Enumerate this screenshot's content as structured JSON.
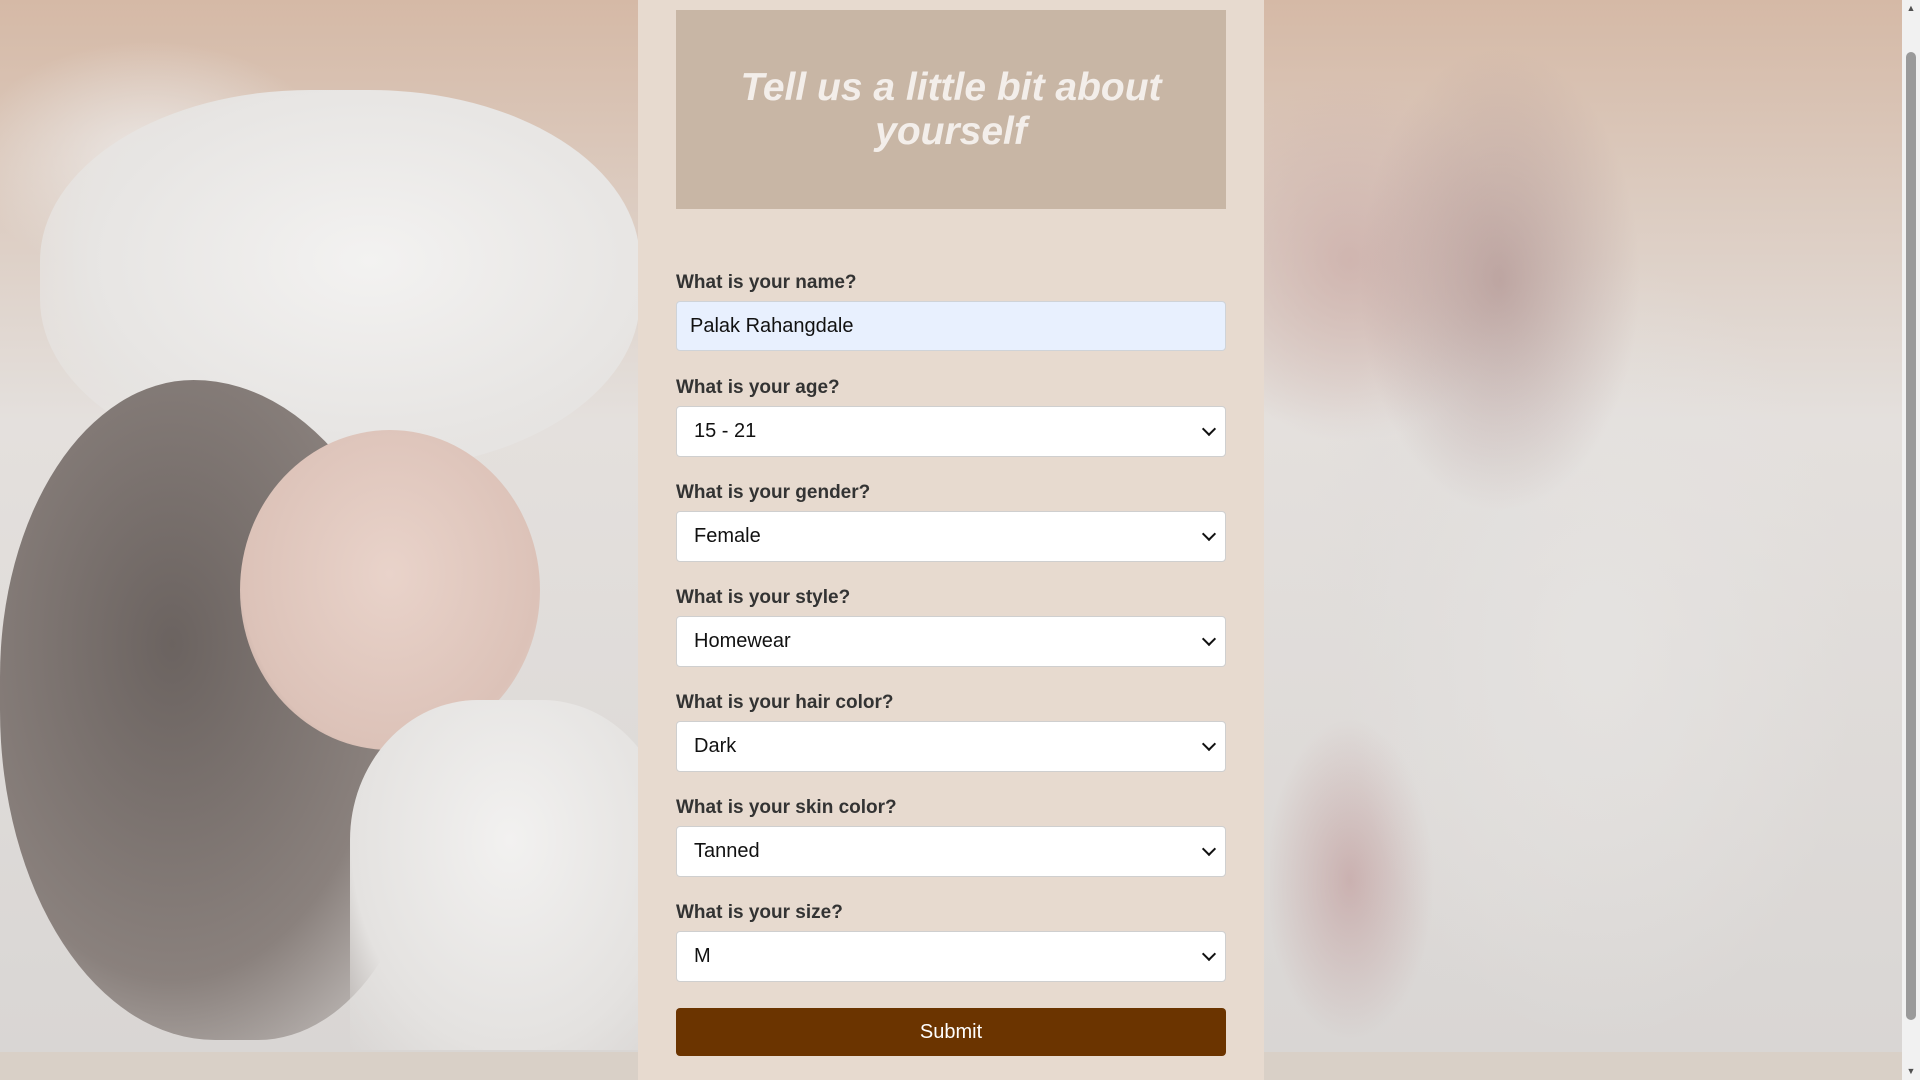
{
  "form": {
    "heading": "Tell us a little bit about yourself",
    "fields": [
      {
        "label": "What is your name?",
        "value": "Palak Rahangdale"
      },
      {
        "label": "What is your age?",
        "value": "15 - 21"
      },
      {
        "label": "What is your gender?",
        "value": "Female"
      },
      {
        "label": "What is your style?",
        "value": "Homewear"
      },
      {
        "label": "What is your hair color?",
        "value": "Dark"
      },
      {
        "label": "What is your skin color?",
        "value": "Tanned"
      },
      {
        "label": "What is your size?",
        "value": "M"
      }
    ],
    "submit_label": "Submit"
  },
  "icons": {
    "select_arrow": "chevron-down-icon",
    "scroll_up": "arrow-up-icon",
    "scroll_down": "arrow-down-icon"
  },
  "colors": {
    "panel_bg": "#e7dacf",
    "header_bg": "#c8b6a5",
    "submit_bg": "#6b3400",
    "autofill_bg": "#e8f0fe"
  }
}
